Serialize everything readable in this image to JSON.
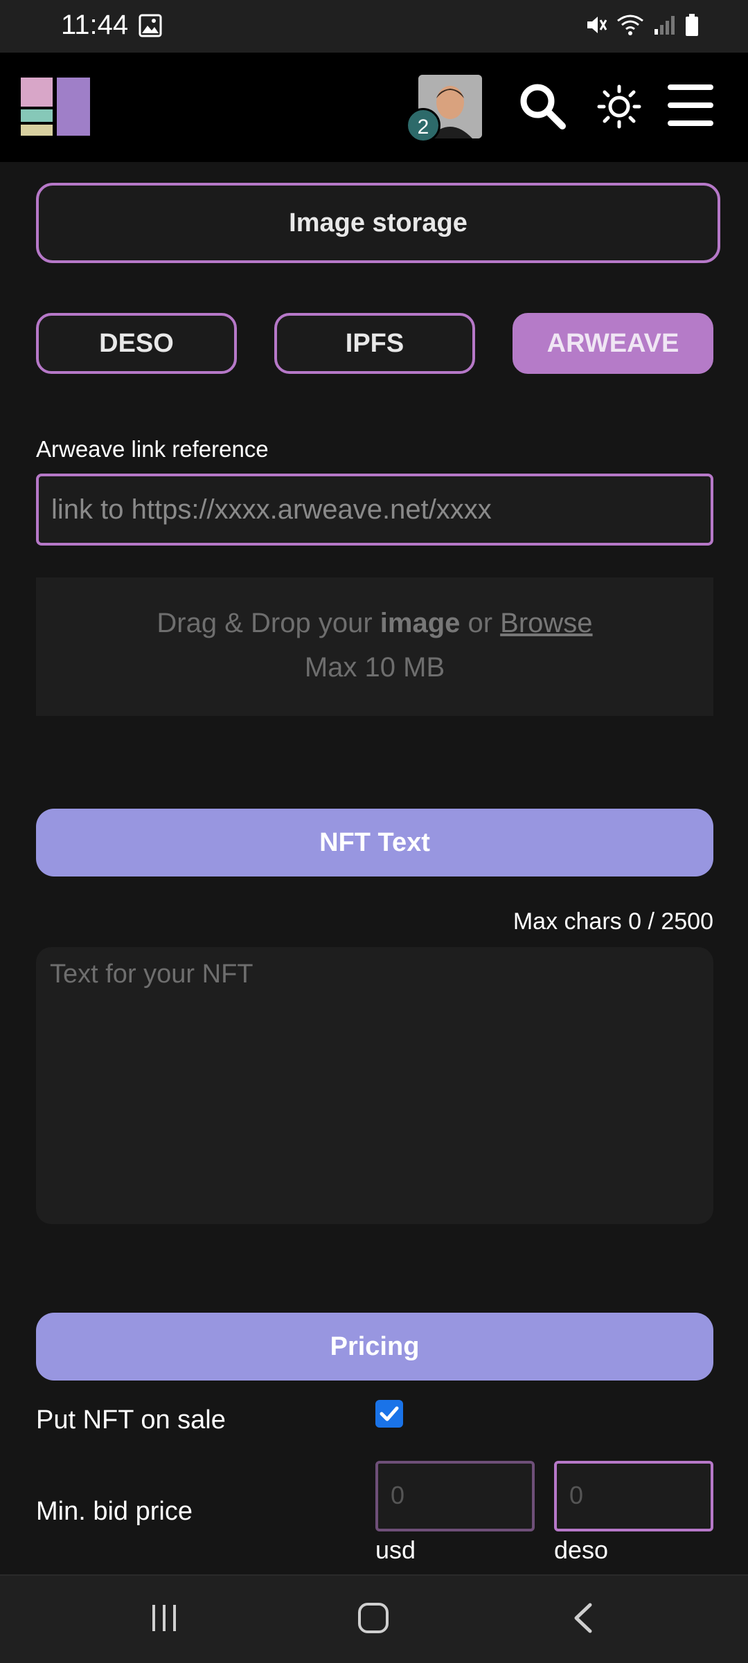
{
  "status_bar": {
    "time": "11:44"
  },
  "header": {
    "notification_count": "2"
  },
  "image_storage": {
    "title": "Image storage",
    "options": [
      "DESO",
      "IPFS",
      "ARWEAVE"
    ],
    "selected": "ARWEAVE"
  },
  "arweave": {
    "label": "Arweave link reference",
    "placeholder": "link to https://xxxx.arweave.net/xxxx"
  },
  "dropzone": {
    "prefix": "Drag & Drop your ",
    "bold_word": "image",
    "middle": " or ",
    "browse": "Browse",
    "limit": "Max 10 MB"
  },
  "nft_text": {
    "title": "NFT Text",
    "counter": "Max chars 0 / 2500",
    "placeholder": "Text for your NFT"
  },
  "pricing": {
    "title": "Pricing",
    "on_sale_label": "Put NFT on sale",
    "on_sale_checked": true,
    "min_bid_label": "Min. bid price",
    "usd_value": "0",
    "usd_label": "usd",
    "deso_value": "0",
    "deso_label": "deso"
  },
  "colors": {
    "accent_border": "#b678c8",
    "section_bar": "#9896e0",
    "active_option": "#b57bc8"
  }
}
